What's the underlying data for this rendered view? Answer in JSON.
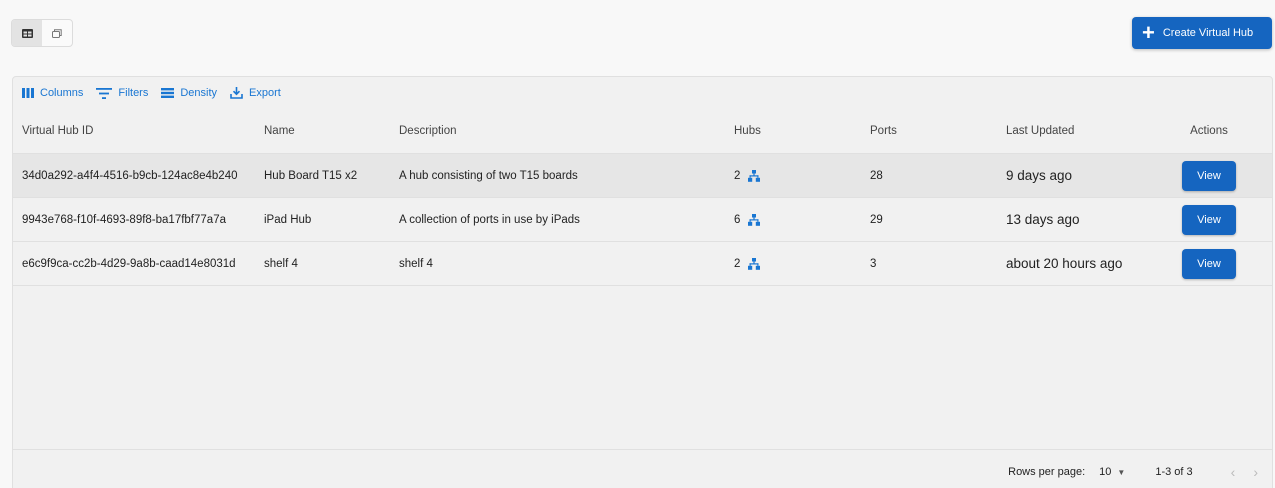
{
  "view_toggle": {
    "grid_icon": "table-view-icon",
    "card_icon": "card-view-icon"
  },
  "create_button": {
    "icon": "plus-icon",
    "label": "Create Virtual Hub"
  },
  "toolbar": {
    "columns": {
      "icon": "columns-icon",
      "label": "Columns"
    },
    "filters": {
      "icon": "filter-icon",
      "label": "Filters"
    },
    "density": {
      "icon": "density-icon",
      "label": "Density"
    },
    "export": {
      "icon": "export-icon",
      "label": "Export"
    }
  },
  "table": {
    "headers": {
      "id": "Virtual Hub ID",
      "name": "Name",
      "description": "Description",
      "hubs": "Hubs",
      "ports": "Ports",
      "last_updated": "Last Updated",
      "actions": "Actions"
    },
    "rows": [
      {
        "id": "34d0a292-a4f4-4516-b9cb-124ac8e4b240",
        "name": "Hub Board T15 x2",
        "description": "A hub consisting of two T15 boards",
        "hubs": "2",
        "ports": "28",
        "last_updated": "9 days ago",
        "action": "View"
      },
      {
        "id": "9943e768-f10f-4693-89f8-ba17fbf77a7a",
        "name": "iPad Hub",
        "description": "A collection of ports in use by iPads",
        "hubs": "6",
        "ports": "29",
        "last_updated": "13 days ago",
        "action": "View"
      },
      {
        "id": "e6c9f9ca-cc2b-4d29-9a8b-caad14e8031d",
        "name": "shelf 4",
        "description": "shelf 4",
        "hubs": "2",
        "ports": "3",
        "last_updated": "about 20 hours ago",
        "action": "View"
      }
    ]
  },
  "footer": {
    "rows_per_page_label": "Rows per page:",
    "rows_per_page_value": "10",
    "range": "1-3 of 3",
    "prev": "‹",
    "next": "›"
  },
  "colors": {
    "primary": "#1565c0",
    "link": "#1976d2",
    "background": "#f8f8f8",
    "grid_bg": "#f1f1f1"
  }
}
